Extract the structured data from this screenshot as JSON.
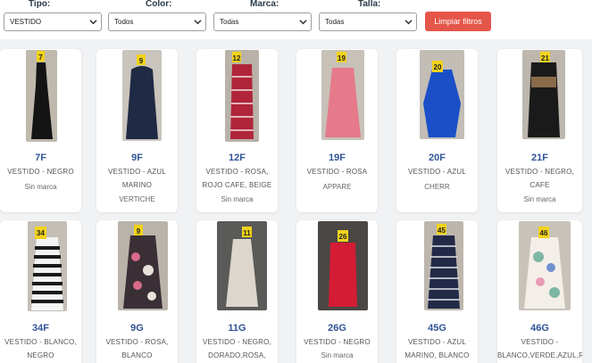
{
  "filters": {
    "tipo": {
      "label": "Tipo:",
      "value": "VESTIDO"
    },
    "color": {
      "label": "Color:",
      "value": "Todos"
    },
    "marca": {
      "label": "Marca:",
      "value": "Todas"
    },
    "talla": {
      "label": "Talla:",
      "value": "Todas"
    },
    "clear_button": "Limpiar filtros"
  },
  "colors": {
    "accent": "#2f5496",
    "button": "#e45649"
  },
  "products": [
    {
      "code": "7F",
      "desc": "VESTIDO - NEGRO",
      "brand": "Sin marca",
      "marker": "7"
    },
    {
      "code": "9F",
      "desc": "VESTIDO - AZUL MARINO",
      "brand": "VERTICHE",
      "marker": "9"
    },
    {
      "code": "12F",
      "desc": "VESTIDO - ROSA, ROJO CAFE, BEIGE",
      "brand": "Sin marca",
      "marker": "12"
    },
    {
      "code": "19F",
      "desc": "VESTIDO - ROSA",
      "brand": "APPARE",
      "marker": "19"
    },
    {
      "code": "20F",
      "desc": "VESTIDO - AZUL",
      "brand": "CHERR",
      "marker": "20"
    },
    {
      "code": "21F",
      "desc": "VESTIDO - NEGRO, CAFE",
      "brand": "Sin marca",
      "marker": "21"
    },
    {
      "code": "34F",
      "desc": "VESTIDO - BLANCO, NEGRO",
      "brand": "",
      "marker": "34"
    },
    {
      "code": "9G",
      "desc": "VESTIDO - ROSA, BLANCO",
      "brand": "",
      "marker": "9"
    },
    {
      "code": "11G",
      "desc": "VESTIDO - NEGRO, DORADO,ROSA,",
      "brand": "",
      "marker": "11"
    },
    {
      "code": "26G",
      "desc": "VESTIDO - NEGRO",
      "brand": "Sin marca",
      "marker": "26"
    },
    {
      "code": "45G",
      "desc": "VESTIDO - AZUL MARINO, BLANCO",
      "brand": "",
      "marker": "45"
    },
    {
      "code": "46G",
      "desc": "VESTIDO - BLANCO,VERDE,AZUL,ROS",
      "brand": "",
      "marker": "46"
    }
  ]
}
